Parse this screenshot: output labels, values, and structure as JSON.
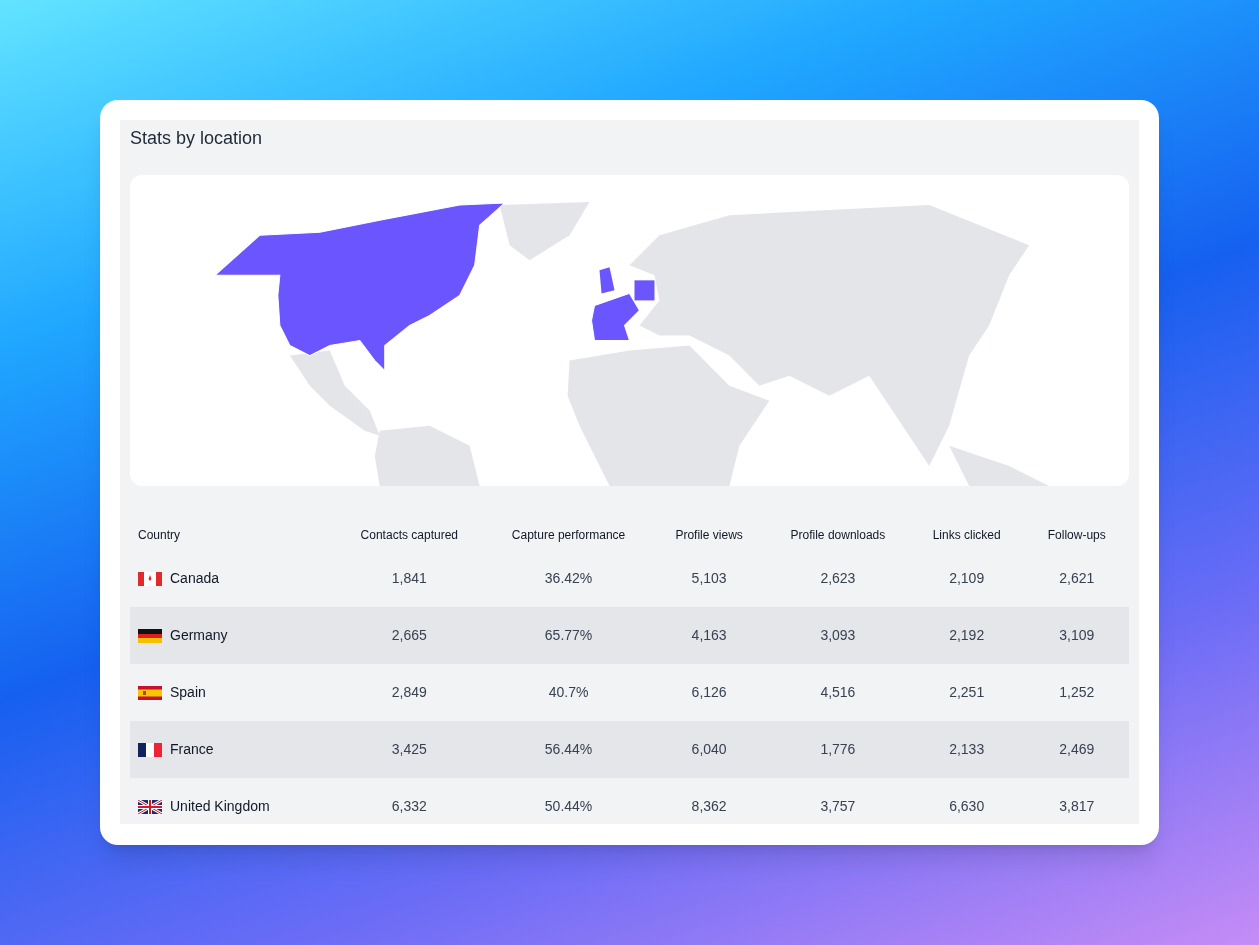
{
  "title": "Stats by location",
  "table": {
    "columns": [
      "Country",
      "Contacts captured",
      "Capture performance",
      "Profile views",
      "Profile downloads",
      "Links clicked",
      "Follow-ups"
    ],
    "rows": [
      {
        "cells": [
          "Canada",
          "1,841",
          "36.42%",
          "5,103",
          "2,623",
          "2,109",
          "2,621"
        ]
      },
      {
        "cells": [
          "Germany",
          "2,665",
          "65.77%",
          "4,163",
          "3,093",
          "2,192",
          "3,109"
        ]
      },
      {
        "cells": [
          "Spain",
          "2,849",
          "40.7%",
          "6,126",
          "4,516",
          "2,251",
          "1,252"
        ]
      },
      {
        "cells": [
          "France",
          "3,425",
          "56.44%",
          "6,040",
          "1,776",
          "2,133",
          "2,469"
        ]
      },
      {
        "cells": [
          "United Kingdom",
          "6,332",
          "50.44%",
          "8,362",
          "3,757",
          "6,630",
          "3,817"
        ]
      }
    ]
  }
}
